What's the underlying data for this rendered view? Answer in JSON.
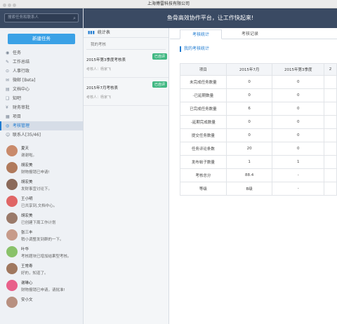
{
  "window": {
    "title": "上海傅雷科技有限公司"
  },
  "header": {
    "slogan": "鱼骨高效协作平台，让工作快起来!"
  },
  "sidebar": {
    "search_placeholder": "搜索任务和联系人",
    "new_task": "新建任务",
    "items": [
      {
        "label": "任务",
        "icon": "circle-icon"
      },
      {
        "label": "工作总结",
        "icon": "edit-icon"
      },
      {
        "label": "人事行政",
        "icon": "pin-icon"
      },
      {
        "label": "微邮 [Beta]",
        "icon": "mail-icon"
      },
      {
        "label": "文档中心",
        "icon": "folder-icon"
      },
      {
        "label": "知吧",
        "icon": "chat-icon"
      },
      {
        "label": "财务审批",
        "icon": "money-icon"
      },
      {
        "label": "项目",
        "icon": "grid-icon"
      },
      {
        "label": "考核管理",
        "icon": "target-icon",
        "active": true
      },
      {
        "label": "联系人[35/46]",
        "icon": "people-icon"
      }
    ],
    "contacts": [
      {
        "name": "夏天",
        "msg": "谢谢啦。",
        "color": "#c98a6b",
        "initial": "夏"
      },
      {
        "name": "胡宏美",
        "msg": "财物报销已申请!",
        "color": "#b07a5c",
        "initial": "胡"
      },
      {
        "name": "胡宏美",
        "msg": "发财事宜讨论下。",
        "color": "#8b6a5a",
        "initial": "胡"
      },
      {
        "name": "王小明",
        "msg": "已共享到,文档中心。",
        "color": "#e06666",
        "initial": "小明"
      },
      {
        "name": "胡宏美",
        "msg": "已创建下周工作计划",
        "color": "#9a7a6a",
        "initial": "胡"
      },
      {
        "name": "张三丰",
        "msg": "稍小调整发到群的一下。",
        "color": "#c79b8a",
        "initial": "张"
      },
      {
        "name": "叶华",
        "msg": "考核题块已增加结果型考核。",
        "color": "#8ac26a",
        "initial": "华"
      },
      {
        "name": "王常寿",
        "msg": "好的，知道了。",
        "color": "#a0785f",
        "initial": "王"
      },
      {
        "name": "谢琳心",
        "msg": "财物报销已申请，请批准!",
        "color": "#e8608a",
        "initial": "心"
      },
      {
        "name": "安小文",
        "msg": "",
        "color": "#b89080",
        "initial": "安"
      }
    ]
  },
  "midpanel": {
    "header": "统计表",
    "sub": "我的考核",
    "reports": [
      {
        "title": "2015年第3季度考核表",
        "reviewer": "考核人：杨家飞",
        "badge": "已自评"
      },
      {
        "title": "2015年7月考核表",
        "reviewer": "考核人：杨家飞",
        "badge": "已自评"
      }
    ]
  },
  "main": {
    "tabs": [
      "考核统计",
      "考核记录"
    ],
    "section_title": "我的考核统计",
    "table": {
      "headers": [
        "项目",
        "2015年7月",
        "2015年第3季度",
        "2"
      ],
      "rows": [
        [
          "未完成任务数量",
          "0",
          "0",
          ""
        ],
        [
          "-已延期数量",
          "0",
          "0",
          ""
        ],
        [
          "已完成任务数量",
          "6",
          "0",
          ""
        ],
        [
          "-延期完成数量",
          "0",
          "0",
          ""
        ],
        [
          "提交任务数量",
          "0",
          "0",
          ""
        ],
        [
          "任务评论条数",
          "20",
          "0",
          ""
        ],
        [
          "发布帖子数量",
          "1",
          "1",
          ""
        ],
        [
          "考核总分",
          "88.4",
          "-",
          ""
        ],
        [
          "等级",
          "B级",
          "-",
          ""
        ]
      ]
    }
  }
}
